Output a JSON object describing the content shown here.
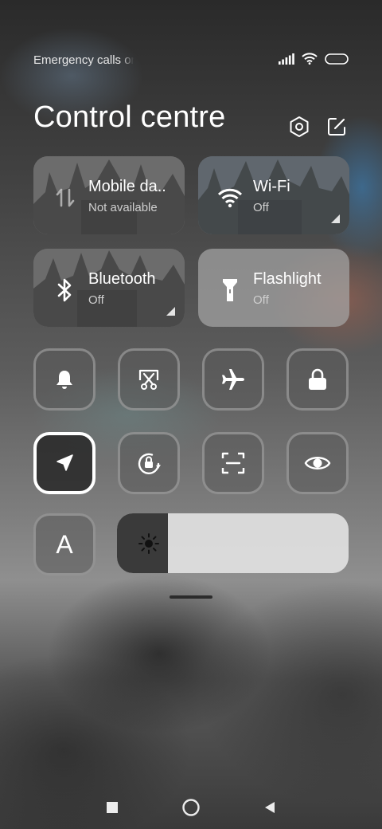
{
  "status_bar": {
    "carrier_text": "Emergency calls only",
    "icons": [
      "signal-icon",
      "wifi-icon",
      "battery-icon"
    ]
  },
  "header": {
    "title": "Control centre",
    "settings_icon": "settings-hexagon-icon",
    "edit_icon": "edit-icon"
  },
  "tiles": [
    {
      "name": "Mobile da..",
      "state": "Not available",
      "icon": "mobile-data-icon",
      "active": false
    },
    {
      "name": "Wi-Fi",
      "state": "Off",
      "icon": "wifi-icon",
      "active": false
    },
    {
      "name": "Bluetooth",
      "state": "Off",
      "icon": "bluetooth-icon",
      "active": false
    },
    {
      "name": "Flashlight",
      "state": "Off",
      "icon": "flashlight-icon",
      "active": true
    }
  ],
  "toggles": [
    {
      "icon": "bell-icon",
      "on": false
    },
    {
      "icon": "screenshot-icon",
      "on": false
    },
    {
      "icon": "airplane-icon",
      "on": false
    },
    {
      "icon": "lock-icon",
      "on": false
    },
    {
      "icon": "location-icon",
      "on": true
    },
    {
      "icon": "rotation-lock-icon",
      "on": false
    },
    {
      "icon": "scan-icon",
      "on": false
    },
    {
      "icon": "eye-icon",
      "on": false
    }
  ],
  "auto_brightness": {
    "label": "A",
    "icon": "auto-brightness-icon"
  },
  "brightness": {
    "level": 0.22,
    "icon": "sun-icon"
  },
  "nav": [
    "recents-icon",
    "home-icon",
    "back-icon"
  ]
}
